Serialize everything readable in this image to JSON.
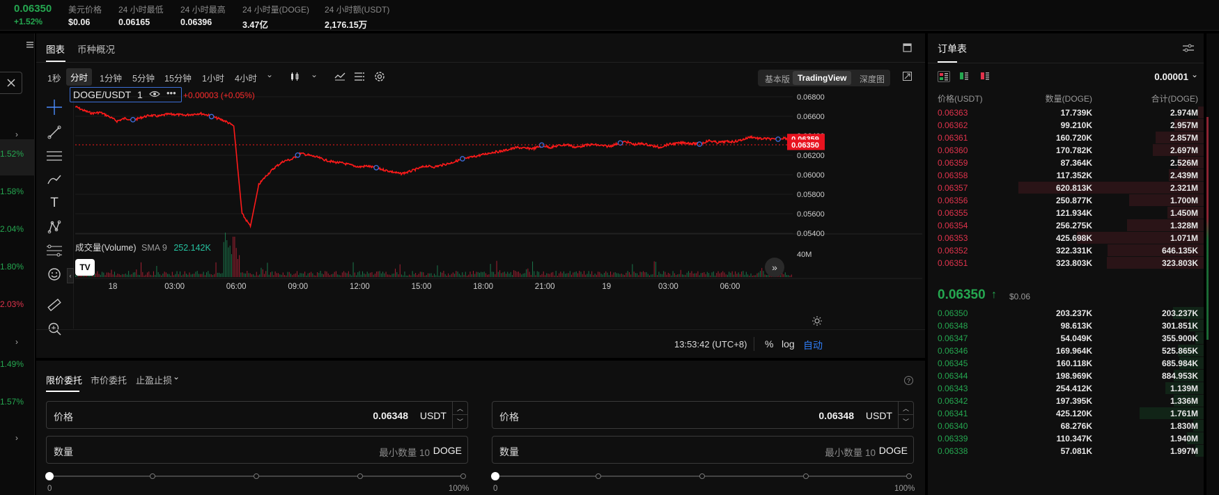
{
  "ticker": {
    "last_price": "0.06350",
    "change": "+1.52%",
    "stats": [
      {
        "label": "美元价格",
        "value": "$0.06"
      },
      {
        "label": "24 小时最低",
        "value": "0.06165"
      },
      {
        "label": "24 小时最高",
        "value": "0.06396"
      },
      {
        "label": "24 小时量(DOGE)",
        "value": "3.47亿"
      },
      {
        "label": "24 小时额(USDT)",
        "value": "2,176.15万"
      }
    ]
  },
  "left_strip": {
    "items": [
      "1.52%",
      "1.58%",
      "2.04%",
      "1.80%",
      "2.03%",
      "1.49%",
      "1.57%"
    ],
    "colors": [
      "#25a750",
      "#25a750",
      "#25a750",
      "#25a750",
      "#e0334c",
      "#25a750",
      "#25a750"
    ]
  },
  "chart_tabs": [
    "图表",
    "币种概况"
  ],
  "intervals": [
    "1秒",
    "分时",
    "1分钟",
    "5分钟",
    "15分钟",
    "1小时",
    "4小时"
  ],
  "active_interval": "分时",
  "view_modes": [
    "基本版",
    "TradingView",
    "深度图"
  ],
  "active_view": "TradingView",
  "legend": {
    "symbol": "DOGE/USDT",
    "interval": "1",
    "change": "+0.00003 (+0.05%)",
    "volume_label": "成交量(Volume)",
    "sma_label": "SMA 9",
    "sma_value": "252.142K"
  },
  "price_tags": {
    "high": "0.06359",
    "last": "0.06350"
  },
  "footer": {
    "time": "13:53:42 (UTC+8)",
    "pct": "%",
    "log": "log",
    "auto": "自动"
  },
  "chart_data": {
    "type": "line",
    "title": "",
    "ylim": [
      0.0535,
      0.0685
    ],
    "yticks": [
      "0.06800",
      "0.06600",
      "0.06400",
      "0.06200",
      "0.06000",
      "0.05800",
      "0.05600",
      "0.05400"
    ],
    "xticks": [
      "18",
      "03:00",
      "06:00",
      "09:00",
      "12:00",
      "15:00",
      "18:00",
      "21:00",
      "19",
      "03:00",
      "06:00"
    ],
    "volume_axis_label": "40M",
    "series": [
      {
        "values": [
          0.067,
          0.0666,
          0.0663,
          0.0664,
          0.066,
          0.0655,
          0.0658,
          0.0656,
          0.0659,
          0.0661,
          0.066,
          0.0662,
          0.0662,
          0.0661,
          0.0662,
          0.0663,
          0.0661,
          0.0658,
          0.0655,
          0.065,
          0.056,
          0.0547,
          0.059,
          0.06,
          0.0608,
          0.0614,
          0.0616,
          0.0622,
          0.062,
          0.0618,
          0.0615,
          0.0613,
          0.0612,
          0.061,
          0.0608,
          0.0609,
          0.0607,
          0.0605,
          0.0603,
          0.0601,
          0.0603,
          0.0606,
          0.0609,
          0.0608,
          0.061,
          0.0612,
          0.0615,
          0.0617,
          0.0619,
          0.0621,
          0.0623,
          0.0624,
          0.0626,
          0.0628,
          0.0627,
          0.0627,
          0.063,
          0.0628,
          0.063,
          0.0631,
          0.0628,
          0.063,
          0.0631,
          0.063,
          0.0629,
          0.0632,
          0.0634,
          0.0631,
          0.0632,
          0.063,
          0.0628,
          0.0631,
          0.0632,
          0.0633,
          0.0632,
          0.0632,
          0.0635,
          0.0633,
          0.0634,
          0.0634,
          0.0636,
          0.0639,
          0.0637,
          0.0637,
          0.0636,
          0.0638,
          0.0635
        ]
      }
    ]
  },
  "order_form": {
    "tabs": [
      "限价委托",
      "市价委托",
      "止盈止损"
    ],
    "left": {
      "price_label": "价格",
      "price_value": "0.06348",
      "price_unit": "USDT",
      "qty_label": "数量",
      "qty_placeholder": "最小数量 10",
      "qty_unit": "DOGE"
    },
    "right": {
      "price_label": "价格",
      "price_value": "0.06348",
      "price_unit": "USDT",
      "qty_label": "数量",
      "qty_placeholder": "最小数量 10",
      "qty_unit": "DOGE"
    },
    "slider_min": "0",
    "slider_max": "100%",
    "slider_value": 0
  },
  "orderbook": {
    "title": "订单表",
    "precision": "0.00001",
    "headers": [
      "价格(USDT)",
      "数量(DOGE)",
      "合计(DOGE)"
    ],
    "asks": [
      {
        "price": "0.06363",
        "amount": "17.739K",
        "total": "2.974M"
      },
      {
        "price": "0.06362",
        "amount": "99.210K",
        "total": "2.957M"
      },
      {
        "price": "0.06361",
        "amount": "160.720K",
        "total": "2.857M"
      },
      {
        "price": "0.06360",
        "amount": "170.782K",
        "total": "2.697M"
      },
      {
        "price": "0.06359",
        "amount": "87.364K",
        "total": "2.526M"
      },
      {
        "price": "0.06358",
        "amount": "117.352K",
        "total": "2.439M"
      },
      {
        "price": "0.06357",
        "amount": "620.813K",
        "total": "2.321M"
      },
      {
        "price": "0.06356",
        "amount": "250.877K",
        "total": "1.700M"
      },
      {
        "price": "0.06355",
        "amount": "121.934K",
        "total": "1.450M"
      },
      {
        "price": "0.06354",
        "amount": "256.275K",
        "total": "1.328M"
      },
      {
        "price": "0.06353",
        "amount": "425.698K",
        "total": "1.071M"
      },
      {
        "price": "0.06352",
        "amount": "322.331K",
        "total": "646.135K"
      },
      {
        "price": "0.06351",
        "amount": "323.803K",
        "total": "323.803K"
      }
    ],
    "mid_price": "0.06350",
    "mid_usd": "$0.06",
    "bids": [
      {
        "price": "0.06350",
        "amount": "203.237K",
        "total": "203.237K"
      },
      {
        "price": "0.06348",
        "amount": "98.613K",
        "total": "301.851K"
      },
      {
        "price": "0.06347",
        "amount": "54.049K",
        "total": "355.900K"
      },
      {
        "price": "0.06346",
        "amount": "169.964K",
        "total": "525.865K"
      },
      {
        "price": "0.06345",
        "amount": "160.118K",
        "total": "685.984K"
      },
      {
        "price": "0.06344",
        "amount": "198.969K",
        "total": "884.953K"
      },
      {
        "price": "0.06343",
        "amount": "254.412K",
        "total": "1.139M"
      },
      {
        "price": "0.06342",
        "amount": "197.395K",
        "total": "1.336M"
      },
      {
        "price": "0.06341",
        "amount": "425.120K",
        "total": "1.761M"
      },
      {
        "price": "0.06340",
        "amount": "68.276K",
        "total": "1.830M"
      },
      {
        "price": "0.06339",
        "amount": "110.347K",
        "total": "1.940M"
      },
      {
        "price": "0.06338",
        "amount": "57.081K",
        "total": "1.997M"
      }
    ]
  },
  "colors": {
    "up": "#25a750",
    "down": "#e0334c",
    "line": "#ff1a1a",
    "accent": "#2f7cf6"
  }
}
